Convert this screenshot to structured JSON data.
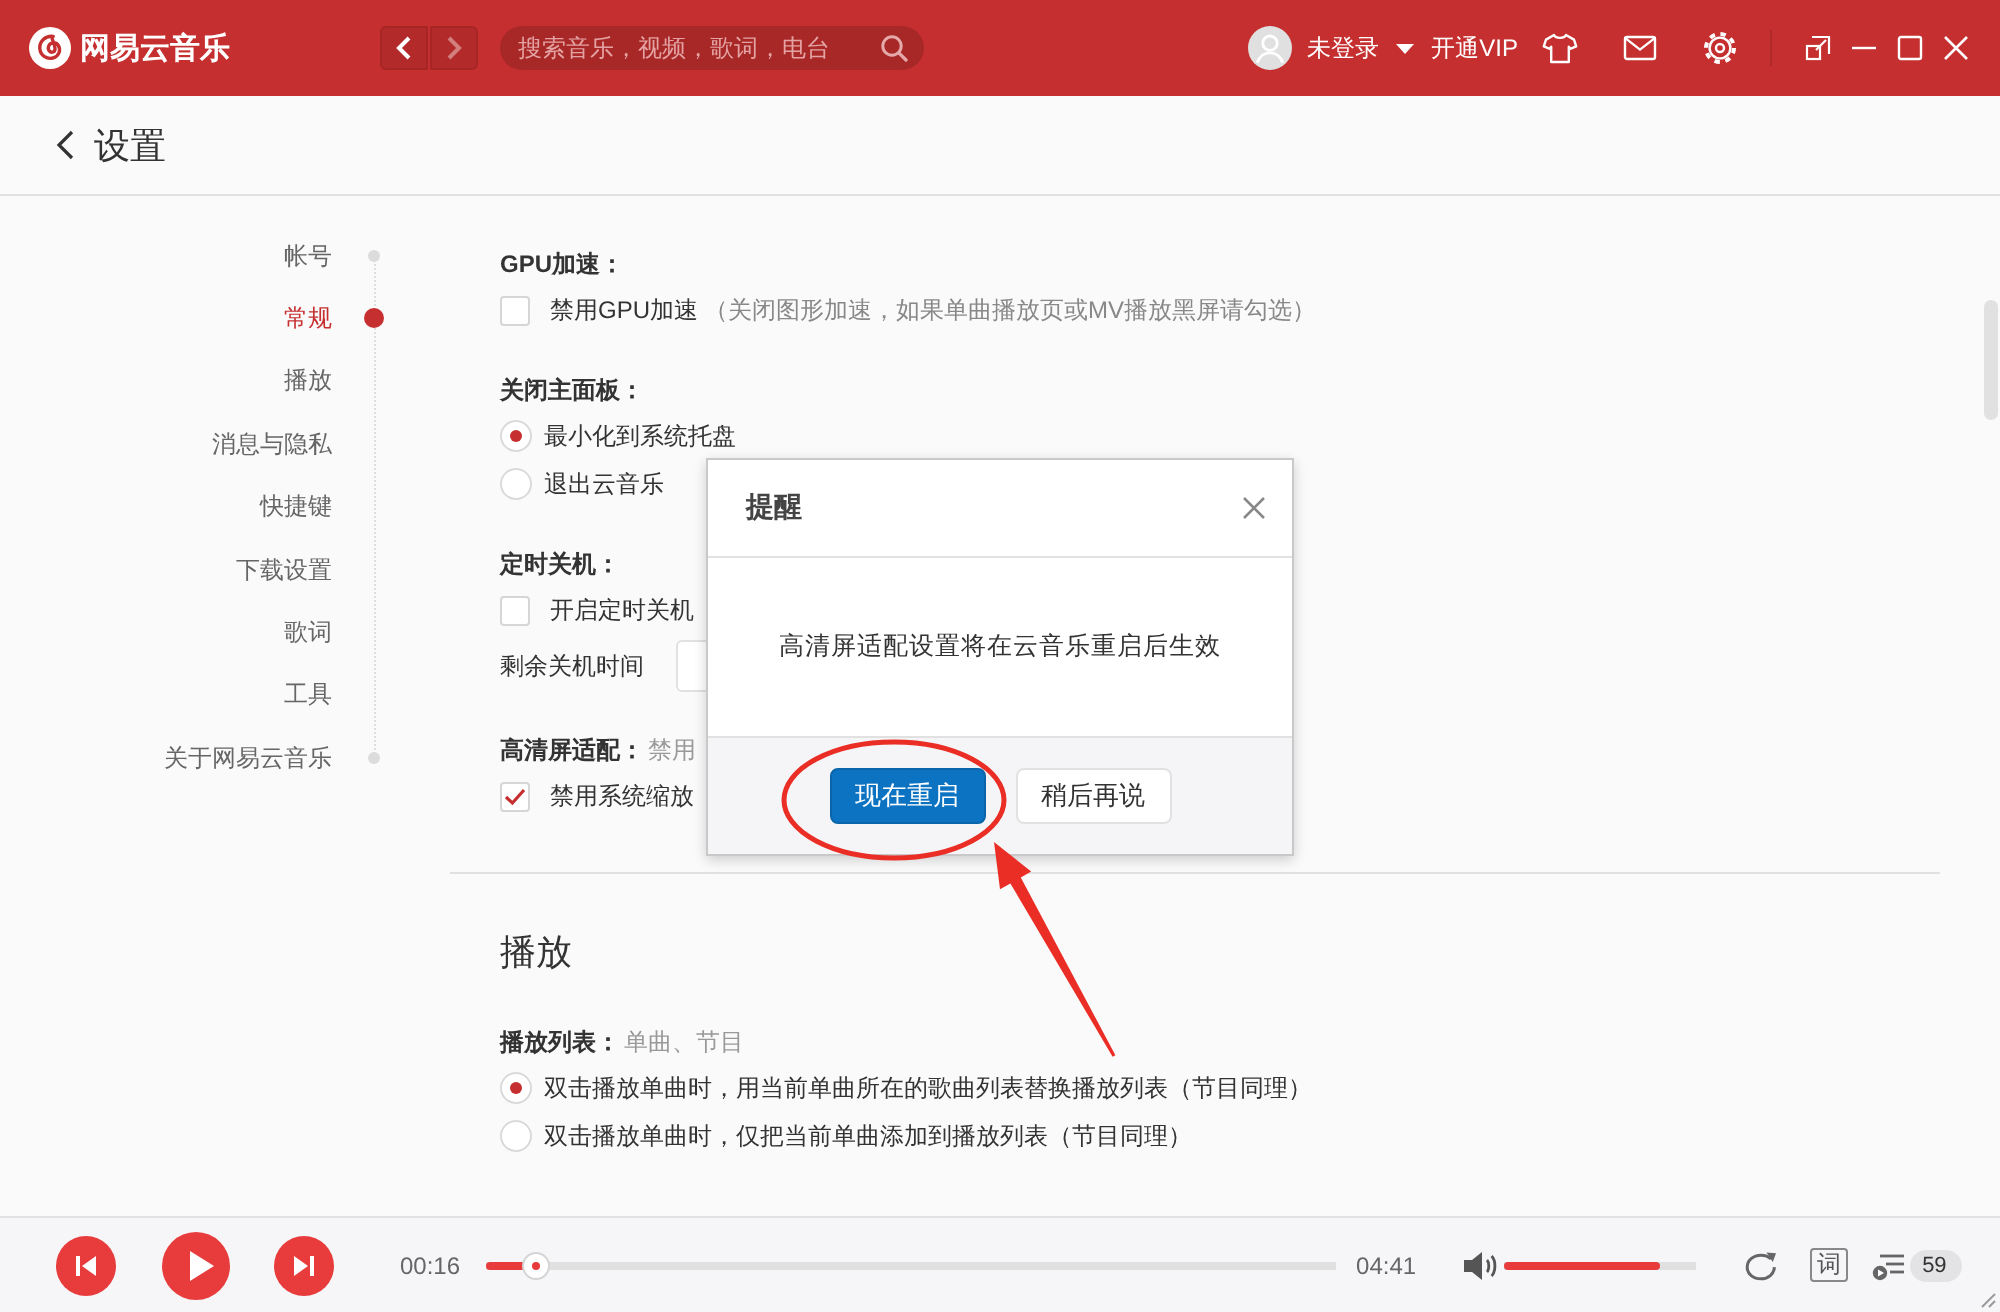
{
  "titlebar": {
    "app_name": "网易云音乐",
    "nav": [
      {
        "kind": "back",
        "disabled": false
      },
      {
        "kind": "forward",
        "disabled": true
      }
    ],
    "search": {
      "placeholder": "搜索音乐，视频，歌词，电台"
    },
    "user": {
      "name": "未登录"
    },
    "vip_link": "开通VIP"
  },
  "page_header": {
    "title": "设置"
  },
  "sidebar": {
    "items": [
      {
        "label": "帐号",
        "selected": false
      },
      {
        "label": "常规",
        "selected": true
      },
      {
        "label": "播放",
        "selected": false
      },
      {
        "label": "消息与隐私",
        "selected": false
      },
      {
        "label": "快捷键",
        "selected": false
      },
      {
        "label": "下载设置",
        "selected": false
      },
      {
        "label": "歌词",
        "selected": false
      },
      {
        "label": "工具",
        "selected": false
      },
      {
        "label": "关于网易云音乐",
        "selected": false
      }
    ]
  },
  "sections": [
    {
      "groups": [
        {
          "title": "GPU加速：",
          "options": [
            {
              "kind": "checkbox",
              "checked": false,
              "label": "禁用GPU加速",
              "note": "（关闭图形加速，如果单曲播放页或MV播放黑屏请勾选）"
            }
          ]
        },
        {
          "title": "关闭主面板：",
          "options": [
            {
              "kind": "radio",
              "selected": true,
              "label": "最小化到系统托盘"
            },
            {
              "kind": "radio",
              "selected": false,
              "label": "退出云音乐"
            }
          ]
        },
        {
          "title": "定时关机：",
          "options": [
            {
              "kind": "checkbox",
              "checked": false,
              "label": "开启定时关机"
            },
            {
              "kind": "field",
              "label": "剩余关机时间"
            }
          ]
        },
        {
          "title": "高清屏适配：",
          "hint": "禁用",
          "options": [
            {
              "kind": "checkbox",
              "checked": true,
              "label": "禁用系统缩放"
            }
          ]
        }
      ]
    },
    {
      "heading": "播放",
      "groups": [
        {
          "title": "播放列表：",
          "hint": "单曲、节目",
          "options": [
            {
              "kind": "radio",
              "selected": true,
              "label": "双击播放单曲时，用当前单曲所在的歌曲列表替换播放列表（节目同理）"
            },
            {
              "kind": "radio",
              "selected": false,
              "label": "双击播放单曲时，仅把当前单曲添加到播放列表（节目同理）"
            }
          ]
        }
      ]
    }
  ],
  "dialog": {
    "title": "提醒",
    "message": "高清屏适配设置将在云音乐重启后生效",
    "buttons": [
      {
        "kind": "primary",
        "label": "现在重启"
      },
      {
        "kind": "secondary",
        "label": "稍后再说"
      }
    ]
  },
  "player": {
    "playing": false,
    "current_time": "00:16",
    "progress": {
      "level": 0.059
    },
    "total_time": "04:41",
    "volume": {
      "level": 0.81
    },
    "lyrics_label": "词",
    "playlist_count": "59"
  }
}
